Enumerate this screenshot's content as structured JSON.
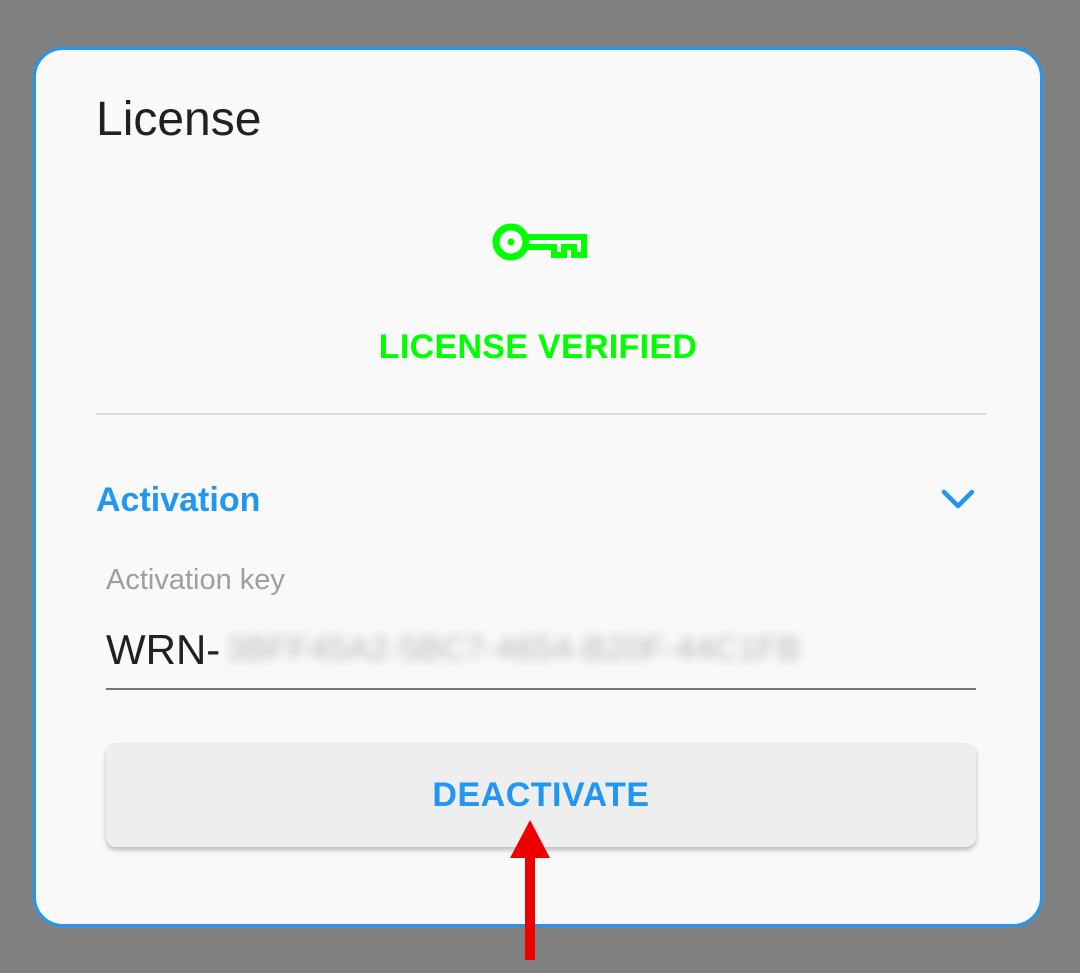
{
  "dialog": {
    "title": "License"
  },
  "status": {
    "icon": "key-icon",
    "text": "LICENSE VERIFIED",
    "color": "#00ff00"
  },
  "activation": {
    "section_title": "Activation",
    "chevron_icon": "chevron-down-icon",
    "field_label": "Activation key",
    "key_prefix": "WRN-",
    "key_redacted": "3BFF45A2-5BC7-4654-B20F-44C1FB",
    "button_label": "DEACTIVATE"
  },
  "annotation": {
    "icon": "red-arrow-icon",
    "color": "#ee0000"
  },
  "colors": {
    "accent": "#2196f3",
    "background_overlay": "#808080"
  }
}
